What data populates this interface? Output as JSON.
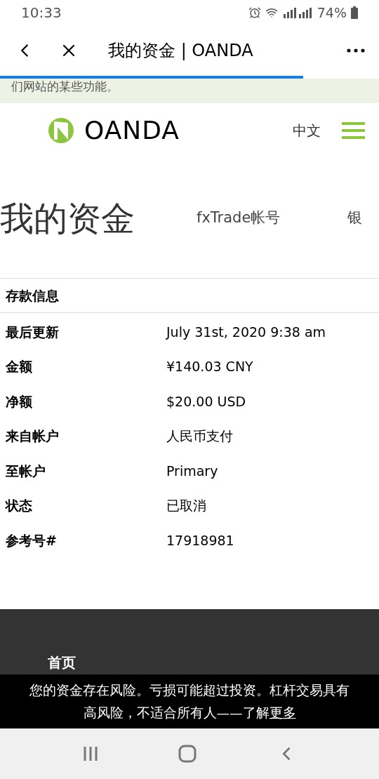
{
  "status_bar": {
    "time": "10:33",
    "battery": "74%"
  },
  "browser_bar": {
    "title": "我的资金 | OANDA",
    "progress": {
      "level": 0.8
    }
  },
  "notice": {
    "text": "们网站的某些功能。"
  },
  "header": {
    "logo": "OANDA",
    "language": "中文"
  },
  "heading": {
    "title": "我的资金",
    "tabs": [
      {
        "label": "fxTrade帐号",
        "selected": false
      },
      {
        "label": "银",
        "selected": false
      }
    ]
  },
  "details": {
    "section": "存款信息",
    "rows": [
      {
        "label": "最后更新",
        "value": "July 31st, 2020 9:38 am"
      },
      {
        "label": "金额",
        "value": "¥140.03 CNY"
      },
      {
        "label": "净额",
        "value": "$20.00 USD"
      },
      {
        "label": "来自帐户",
        "value": "人民币支付"
      },
      {
        "label": "至帐户",
        "value": "Primary"
      },
      {
        "label": "状态",
        "value": "已取消"
      },
      {
        "label": "参考号#",
        "value": "17918981"
      }
    ]
  },
  "footer": {
    "link": "首页"
  },
  "risk_banner": {
    "text": "您的资金存在风险。亏损可能超过投资。杠杆交易具有高风险，不适合所有人——了解",
    "link": "更多"
  }
}
